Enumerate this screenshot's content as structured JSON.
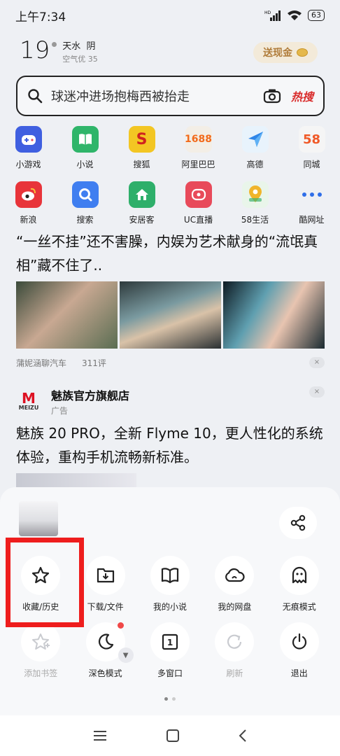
{
  "status": {
    "time": "上午7:34",
    "battery": "63",
    "hd": "HD"
  },
  "weather": {
    "temp": "19",
    "city": "天水",
    "condition": "阴",
    "air": "空气优 35"
  },
  "cash_button": "送现金",
  "search": {
    "placeholder": "球迷冲进场抱梅西被抬走",
    "hot": "热搜"
  },
  "apps": [
    {
      "label": "小游戏",
      "color": "#3f5fe0",
      "icon": "game-icon"
    },
    {
      "label": "小说",
      "color": "#2fb56a",
      "icon": "book-icon"
    },
    {
      "label": "搜狐",
      "color": "#f3c623",
      "icon": "sohu-icon"
    },
    {
      "label": "阿里巴巴",
      "color": "#f3eee6",
      "icon": "alibaba-icon"
    },
    {
      "label": "高德",
      "color": "#3a9cf2",
      "icon": "amap-icon"
    },
    {
      "label": "同城",
      "color": "#f5f5f5",
      "icon": "58-icon"
    },
    {
      "label": "新浪",
      "color": "#e8343a",
      "icon": "weibo-icon"
    },
    {
      "label": "搜索",
      "color": "#3f7ef0",
      "icon": "search-app-icon"
    },
    {
      "label": "安居客",
      "color": "#2eaf6a",
      "icon": "house-icon"
    },
    {
      "label": "UC直播",
      "color": "#e84a5a",
      "icon": "live-icon"
    },
    {
      "label": "58生活",
      "color": "#f0b52a",
      "icon": "location-icon"
    },
    {
      "label": "酷网址",
      "color": "transparent",
      "icon": "more-icon"
    }
  ],
  "app_text": {
    "alibaba": "1688",
    "tongcheng": "58",
    "sohu": "S"
  },
  "news": {
    "title": "“一丝不挂”还不害臊，内娱为艺术献身的“流氓真相”藏不住了..",
    "source": "蒲妮涵聊汽车",
    "comments": "311评"
  },
  "ad": {
    "name": "魅族官方旗舰店",
    "tag": "广告",
    "logo_main": "M",
    "logo_sub": "MEIZU",
    "text": "魅族 20 PRO，全新 Flyme 10，更人性化的系统体验，重构手机流畅新标准。"
  },
  "menu": [
    {
      "label": "收藏/历史",
      "icon": "star-icon"
    },
    {
      "label": "下载/文件",
      "icon": "download-folder-icon"
    },
    {
      "label": "我的小说",
      "icon": "open-book-icon"
    },
    {
      "label": "我的网盘",
      "icon": "cloud-icon"
    },
    {
      "label": "无痕模式",
      "icon": "ghost-icon"
    },
    {
      "label": "添加书签",
      "icon": "add-star-icon",
      "disabled": true
    },
    {
      "label": "深色模式",
      "icon": "moon-icon"
    },
    {
      "label": "多窗口",
      "icon": "window-icon",
      "count": "1"
    },
    {
      "label": "刷新",
      "icon": "refresh-icon",
      "disabled": true
    },
    {
      "label": "退出",
      "icon": "power-icon"
    }
  ],
  "close_mark": "×"
}
